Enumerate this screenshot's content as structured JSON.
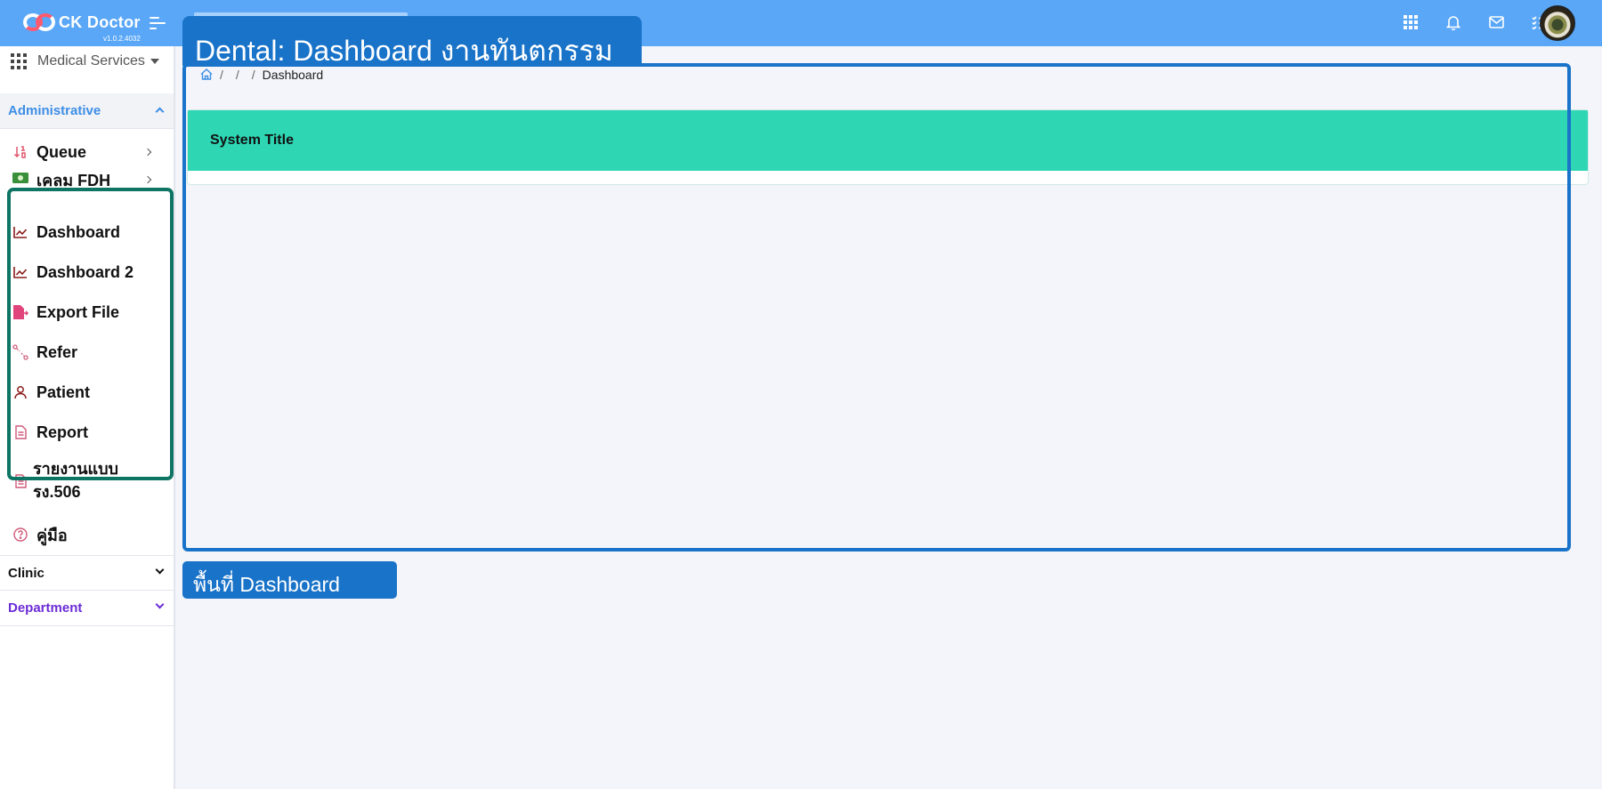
{
  "app": {
    "name": "CK Doctor",
    "version": "v1.0.2.4032"
  },
  "annotations": {
    "title": "Dental: Dashboard งานทันตกรรม",
    "area_label": "พื้นที่ Dashboard"
  },
  "top_icons": [
    "apps-grid-icon",
    "bell-icon",
    "mail-icon",
    "checklist-icon"
  ],
  "sidebar": {
    "service_selector": "Medical Services",
    "groups": {
      "administrative": "Administrative",
      "clinic": "Clinic",
      "department": "Department"
    },
    "items": [
      {
        "label": "Queue",
        "icon": "sort-icon",
        "has_arrow": true
      },
      {
        "label": "เคลม FDH",
        "icon": "money-icon",
        "has_arrow": true
      },
      {
        "label": "Dashboard",
        "icon": "chart-line-icon",
        "has_arrow": false
      },
      {
        "label": "Dashboard 2",
        "icon": "chart-line-icon",
        "has_arrow": false
      },
      {
        "label": "Export File",
        "icon": "file-export-icon",
        "has_arrow": false
      },
      {
        "label": "Refer",
        "icon": "refer-icon",
        "has_arrow": false
      },
      {
        "label": "Patient",
        "icon": "user-icon",
        "has_arrow": false
      },
      {
        "label": "Report",
        "icon": "file-icon",
        "has_arrow": false
      },
      {
        "label": "รายงานแบบ รง.506",
        "line1": "รายงานแบบ",
        "line2": "รง.506",
        "icon": "file-icon",
        "has_arrow": false
      },
      {
        "label": "คู่มือ",
        "icon": "help-circle-icon",
        "has_arrow": false
      }
    ]
  },
  "breadcrumb": {
    "current": "Dashboard"
  },
  "card": {
    "title": "System Title"
  },
  "colors": {
    "topbar": "#5aa7f7",
    "accent_teal": "#2ed6b4",
    "annotation_blue": "#1973c9",
    "annotation_green": "#0e7565",
    "admin_blue": "#3d8ee6",
    "dept_purple": "#6b2bd6"
  }
}
